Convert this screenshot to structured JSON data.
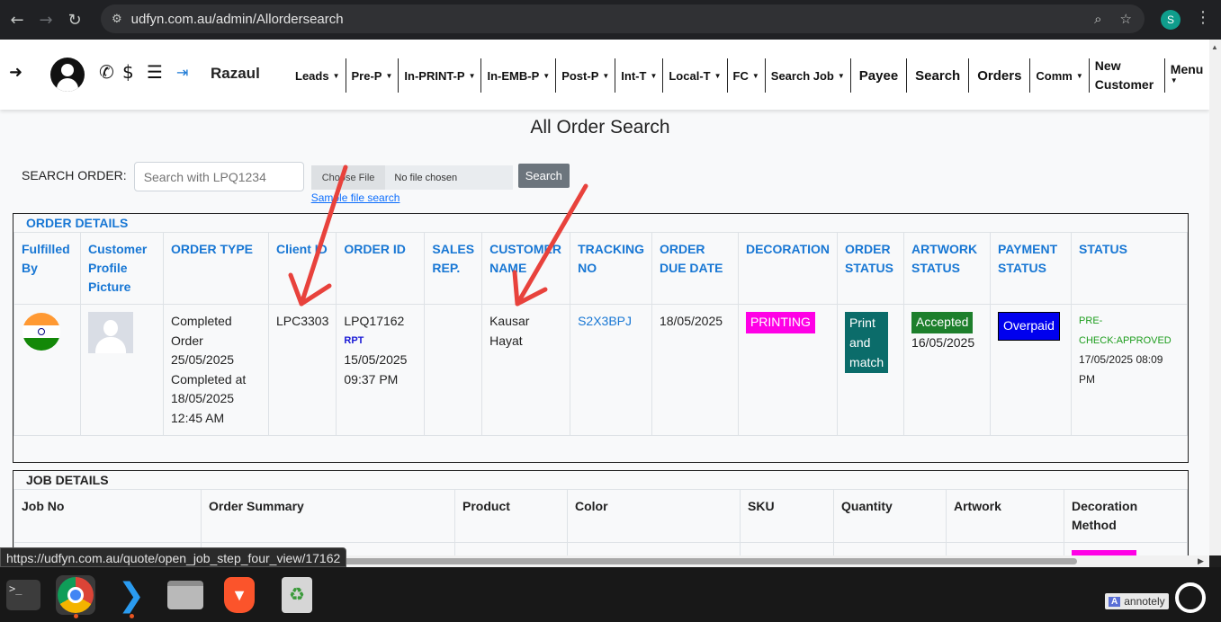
{
  "browser": {
    "url": "udfyn.com.au/admin/Allordersearch",
    "profile_initial": "S",
    "status_url": "https://udfyn.com.au/quote/open_job_step_four_view/17162"
  },
  "nav": {
    "username": "Razaul",
    "menu": [
      {
        "label": "Leads",
        "caret": true
      },
      {
        "label": "Pre-P",
        "caret": true
      },
      {
        "label": "In-PRINT-P",
        "caret": true
      },
      {
        "label": "In-EMB-P",
        "caret": true
      },
      {
        "label": "Post-P",
        "caret": true
      },
      {
        "label": "Int-T",
        "caret": true
      },
      {
        "label": "Local-T",
        "caret": true
      },
      {
        "label": "FC",
        "caret": true
      },
      {
        "label": "Search Job",
        "caret": true
      },
      {
        "label": "Payee",
        "caret": false
      },
      {
        "label": "Search",
        "caret": false
      },
      {
        "label": "Orders",
        "caret": false
      },
      {
        "label": "Comm",
        "caret": true
      }
    ],
    "new_customer": "New Customer",
    "menu_label": "Menu"
  },
  "page": {
    "title": "All Order Search",
    "search_label": "SEARCH ORDER:",
    "search_placeholder": "Search with LPQ1234",
    "file_button": "Choose File",
    "file_status": "No file chosen",
    "sample_link": "Sample file search",
    "search_button": "Search"
  },
  "order_details": {
    "title": "ORDER DETAILS",
    "headers": [
      "Fulfilled By",
      "Customer Profile Picture",
      "ORDER TYPE",
      "Client ID",
      "ORDER ID",
      "SALES REP.",
      "CUSTOMER NAME",
      "TRACKING NO",
      "ORDER DUE DATE",
      "DECORATION",
      "ORDER STATUS",
      "ARTWORK STATUS",
      "PAYMENT STATUS",
      "STATUS"
    ],
    "row": {
      "order_type": [
        "Completed",
        "Order",
        "25/05/2025",
        "Completed at",
        "18/05/2025",
        "12:45 AM"
      ],
      "client_id": "LPC3303",
      "order_id": "LPQ17162",
      "order_tag": "RPT",
      "order_date": "15/05/2025",
      "order_time": "09:37 PM",
      "sales_rep": "",
      "customer_name": "Kausar Hayat",
      "tracking_no": "S2X3BPJ",
      "due_date": "18/05/2025",
      "decoration": "PRINTING",
      "order_status": [
        "Print",
        "and",
        "match"
      ],
      "artwork_status": "Accepted",
      "artwork_date": "16/05/2025",
      "payment_status": "Overpaid",
      "status_text": "PRE-CHECK:APPROVED",
      "status_date": "17/05/2025 08:09 PM"
    }
  },
  "job_details": {
    "title": "JOB DETAILS",
    "headers": [
      "Job No",
      "Order Summary",
      "Product",
      "Color",
      "SKU",
      "Quantity",
      "Artwork",
      "Decoration Method"
    ]
  },
  "dock": {
    "annotely": "annotely"
  },
  "colors": {
    "link_blue": "#1877d4",
    "decoration_magenta": "#ff00e6",
    "order_status_teal": "#0b6c6a",
    "artwork_green": "#1d7f2c",
    "payment_blue": "#0000ee",
    "annotation_red": "#e8423c"
  }
}
